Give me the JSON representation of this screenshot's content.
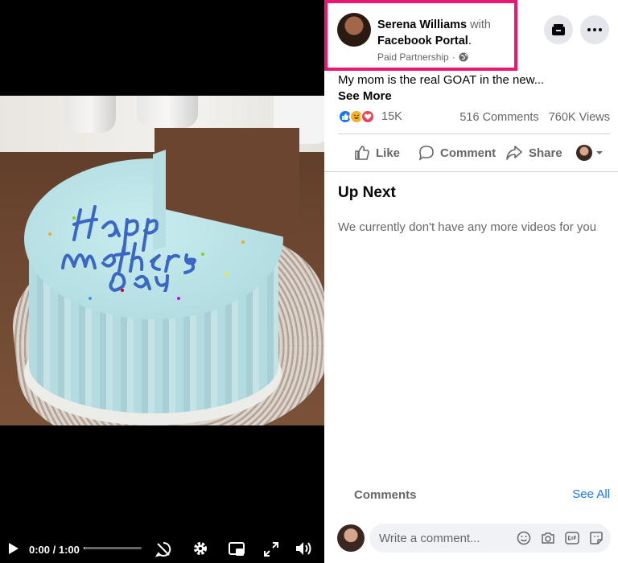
{
  "post": {
    "author": "Serena Williams",
    "with_text": "with",
    "partner": "Facebook Portal",
    "partner_suffix": ".",
    "sponsor_label": "Paid Partnership",
    "sponsor_separator": "·",
    "caption": "My mom is the real GOAT in the new...",
    "see_more": "See More",
    "reaction_count": "15K",
    "comments_count": "516 Comments",
    "views_count": "760K Views"
  },
  "actions": {
    "like": "Like",
    "comment": "Comment",
    "share": "Share"
  },
  "up_next": {
    "title": "Up Next",
    "empty_message": "We currently don't have any more videos for you"
  },
  "comments": {
    "label": "Comments",
    "see_all": "See All",
    "placeholder": "Write a comment..."
  },
  "player": {
    "time": "0:00 / 1:00",
    "progress_fraction": 0.0
  },
  "icons": {
    "play": "play-icon",
    "captions": "captions-off-icon",
    "settings": "gear-icon",
    "miniplayer": "picture-in-picture-icon",
    "fullscreen": "fullscreen-icon",
    "volume": "volume-icon",
    "save": "save-icon",
    "more": "more-icon",
    "globe": "globe-icon",
    "emoji": "emoji-icon",
    "camera": "camera-icon",
    "gif": "gif-icon",
    "sticker": "sticker-icon"
  },
  "colors": {
    "highlight_border": "#e8176f",
    "link_blue": "#1877f2",
    "secondary_text": "#65676b",
    "like_blue": "#1877f2",
    "love_red": "#f33e58",
    "haha_yellow": "#f7b125"
  }
}
